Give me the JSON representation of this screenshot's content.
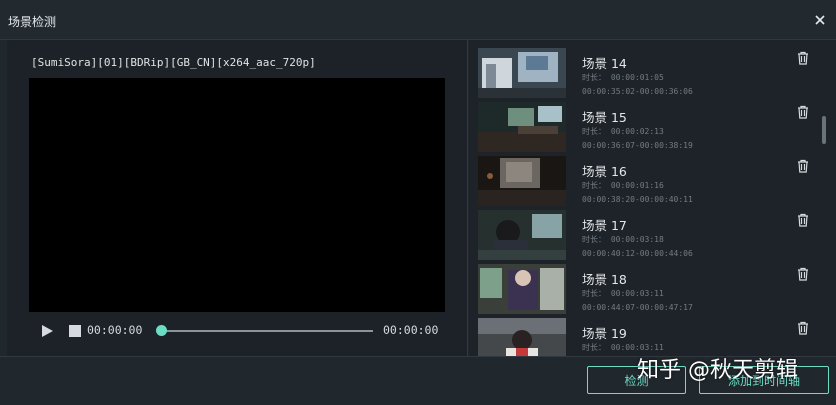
{
  "dialog": {
    "title": "场景检测",
    "close_label": "×"
  },
  "player": {
    "filename": "[SumiSora][01][BDRip][GB_CN][x264_aac_720p]",
    "current_time": "00:00:00",
    "total_time": "00:00:00",
    "progress": 0
  },
  "scenes": [
    {
      "name": "场景 14",
      "duration": "时长： 00:00:01:05",
      "range": "00:00:35:02-00:00:36:06"
    },
    {
      "name": "场景 15",
      "duration": "时长： 00:00:02:13",
      "range": "00:00:36:07-00:00:38:19"
    },
    {
      "name": "场景 16",
      "duration": "时长： 00:00:01:16",
      "range": "00:00:38:20-00:00:40:11"
    },
    {
      "name": "场景 17",
      "duration": "时长： 00:00:03:18",
      "range": "00:00:40:12-00:00:44:06"
    },
    {
      "name": "场景 18",
      "duration": "时长： 00:00:03:11",
      "range": "00:00:44:07-00:00:47:17"
    },
    {
      "name": "场景 19",
      "duration": "时长： 00:00:03:11",
      "range": ""
    }
  ],
  "footer": {
    "detect_label": "检测",
    "add_label": "添加到时间轴"
  },
  "watermark": {
    "text": "知乎 @秋天剪辑"
  },
  "colors": {
    "accent": "#6ddcc5",
    "background": "#20272d"
  }
}
